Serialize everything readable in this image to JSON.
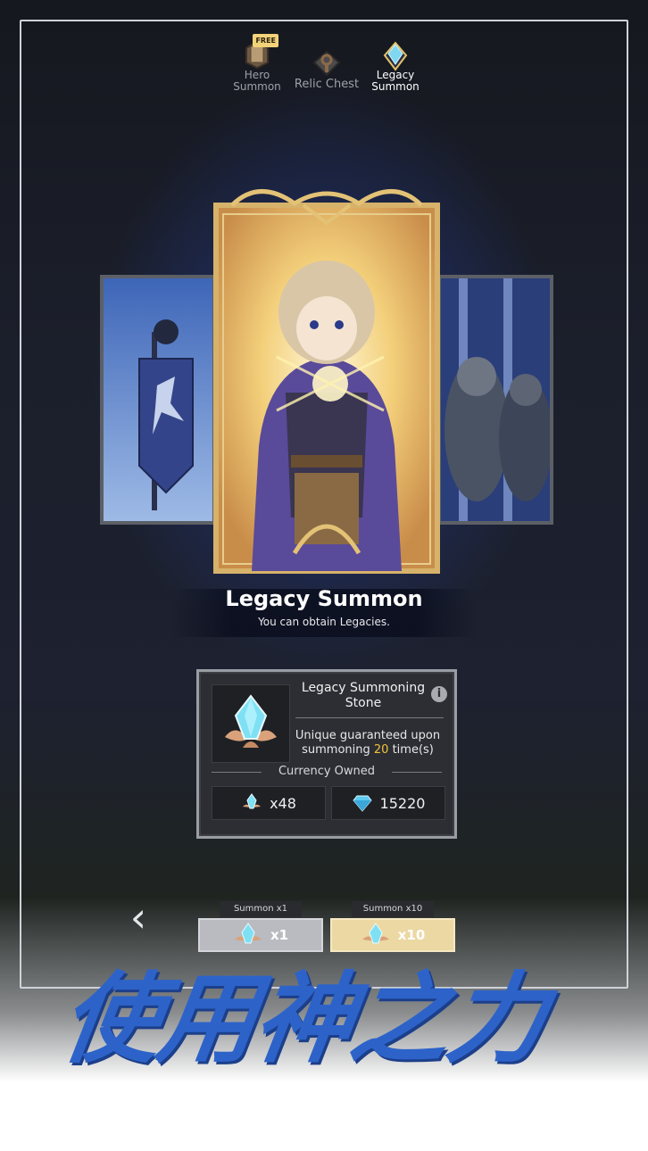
{
  "tabs": [
    {
      "label": "Hero\nSummon",
      "badge": "FREE",
      "icon": "scroll-icon"
    },
    {
      "label": "Relic Chest",
      "icon": "key-chest-icon"
    },
    {
      "label": "Legacy\nSummon",
      "icon": "crystal-icon",
      "active": true
    }
  ],
  "summon_mode": {
    "title": "Legacy Summon",
    "subtitle": "You can obtain Legacies."
  },
  "info_panel": {
    "item_name": "Legacy Summoning Stone",
    "guarantee_prefix": "Unique guaranteed upon summoning ",
    "guarantee_count": "20",
    "guarantee_suffix": " time(s)",
    "currency_label": "Currency Owned",
    "stone_count": "x48",
    "gem_count": "15220"
  },
  "buttons": {
    "summon1_label": "Summon x1",
    "summon1_cost": "x1",
    "summon10_label": "Summon x10",
    "summon10_cost": "x10"
  },
  "promo_text": "使用神之力",
  "colors": {
    "accent_gold": "#f2c23a",
    "promo_blue": "#2d63c9",
    "panel_bg": "#2d2e33"
  }
}
